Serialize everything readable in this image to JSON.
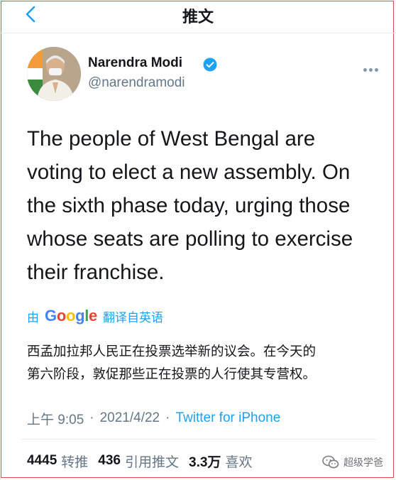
{
  "header": {
    "title": "推文"
  },
  "author": {
    "name": "Narendra Modi",
    "handle": "@narendramodi",
    "verified": true
  },
  "tweet": {
    "lines": [
      "The people of West Bengal are",
      "voting to elect a new assembly. On",
      "the sixth phase today, urging those",
      "whose seats are polling to exercise",
      "their franchise."
    ]
  },
  "translation": {
    "by_label": "由",
    "provider": "Google",
    "from_label": "翻译自英语",
    "lines": [
      "西孟加拉邦人民正在投票选举新的议会。在今天的",
      "第六阶段，敦促那些正在投票的人行使其专营权。"
    ]
  },
  "meta": {
    "time": "上午 9:05",
    "date": "2021/4/22",
    "separator": "·",
    "source": "Twitter for iPhone"
  },
  "stats": {
    "retweets_count": "4445",
    "retweets_label": "转推",
    "quotes_count": "436",
    "quotes_label": "引用推文",
    "likes_count": "3.3万",
    "likes_label": "喜欢"
  },
  "watermark": {
    "text": "超级学爸"
  },
  "colors": {
    "accent": "#1da1f2",
    "text": "#14171a",
    "secondary": "#657786",
    "frame": "#e04b4b"
  },
  "icons": {
    "back": "chevron-left-icon",
    "verified": "verified-badge-icon",
    "more": "more-horizontal-icon",
    "watermark": "wechat-icon"
  }
}
